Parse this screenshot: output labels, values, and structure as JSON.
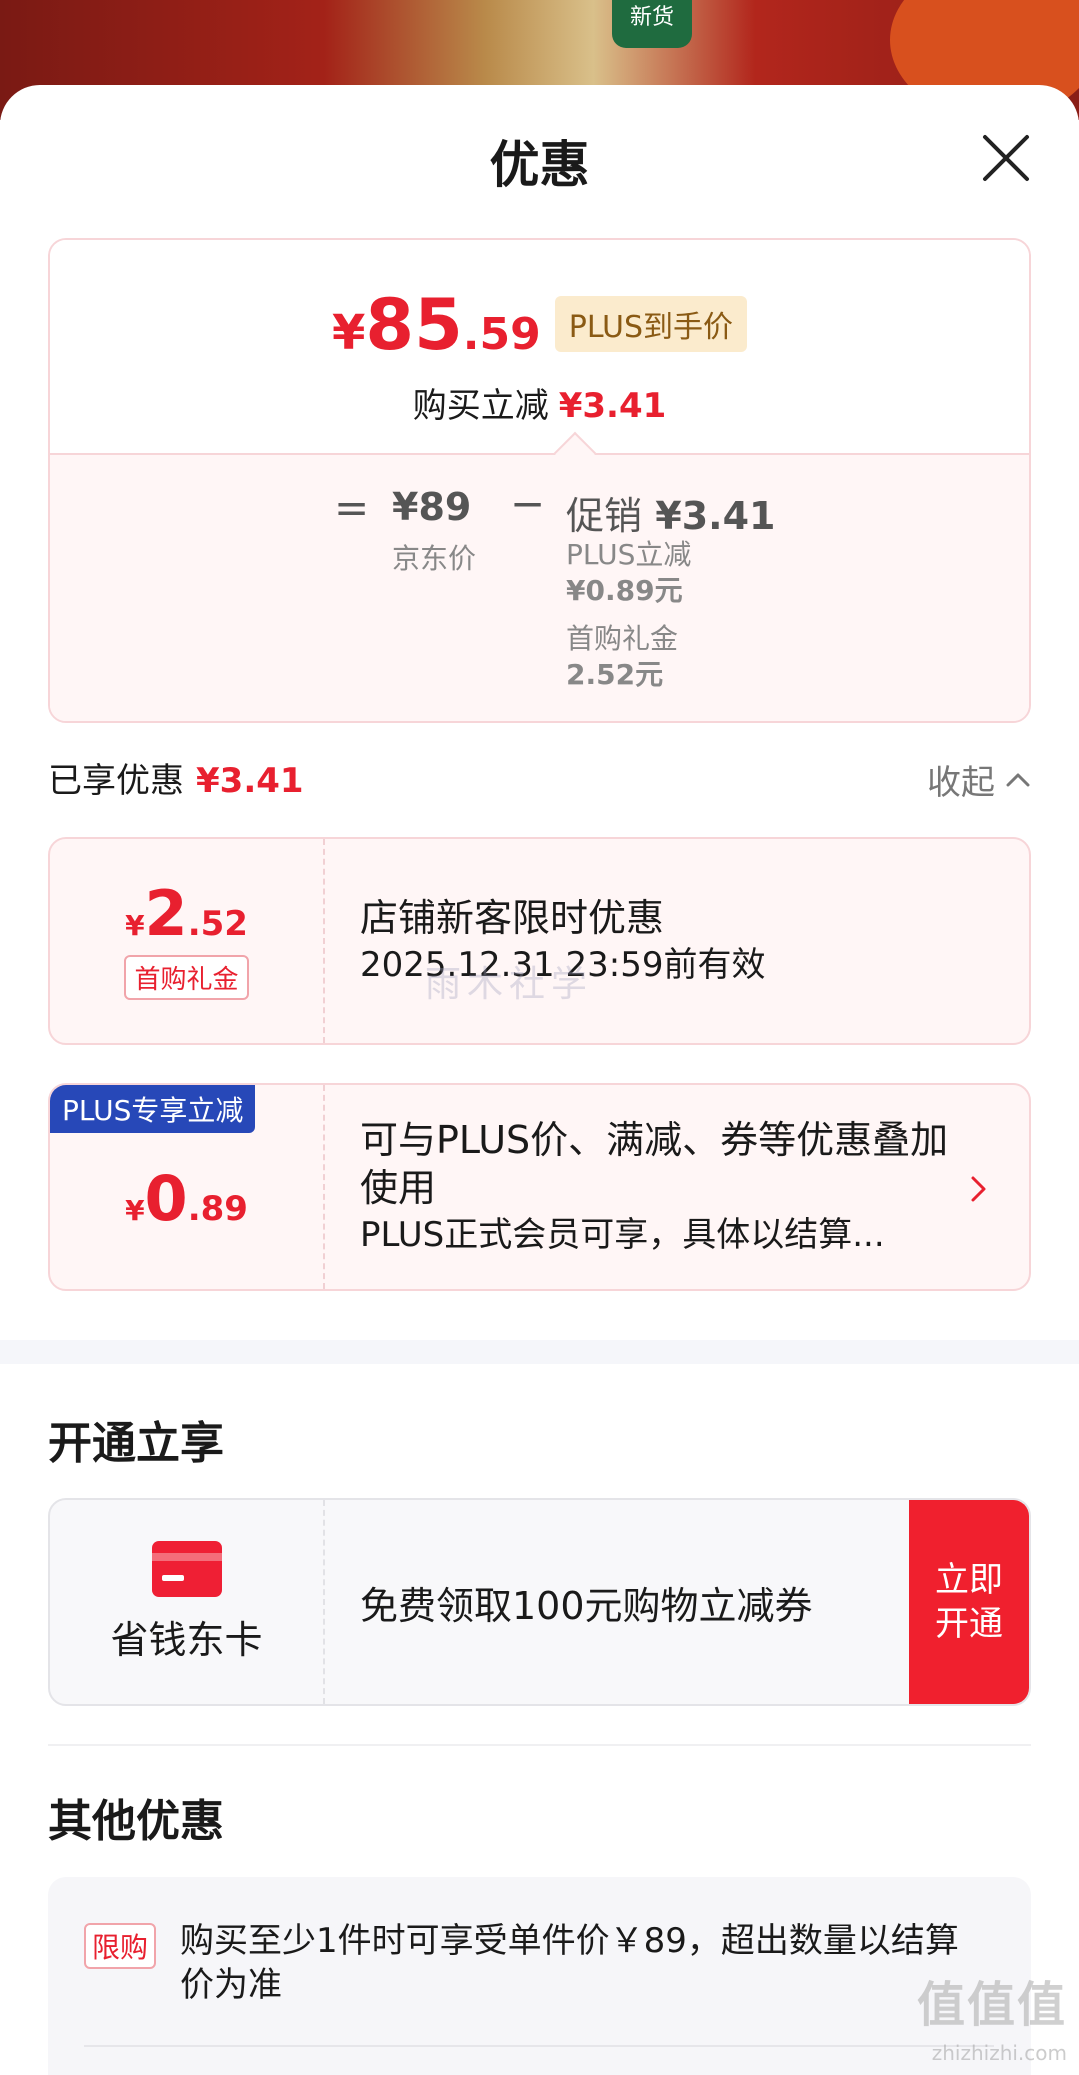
{
  "background": {
    "badge": "新货"
  },
  "sheet": {
    "title": "优惠"
  },
  "summary": {
    "price_yen": "¥",
    "price_int": "85",
    "price_dec": ".59",
    "plus_tag": "PLUS到手价",
    "reduce_label": "购买立减",
    "reduce_amount": "¥3.41",
    "equals": "=",
    "jd_price": "¥89",
    "jd_label": "京东价",
    "minus": "−",
    "promo_label": "促销",
    "promo_amount": "¥3.41",
    "plus_reduce_label": "PLUS立减",
    "plus_reduce_value": "¥0.89元",
    "first_gift_label": "首购礼金",
    "first_gift_value": "2.52元"
  },
  "enjoyed": {
    "label": "已享优惠",
    "amount": "¥3.41",
    "collapse_label": "收起"
  },
  "coupons": [
    {
      "yen": "¥",
      "int": "2",
      "dec": ".52",
      "tag": "首购礼金",
      "title": "店铺新客限时优惠",
      "subtitle": "2025.12.31 23:59前有效"
    },
    {
      "corner": "PLUS专享立减",
      "yen": "¥",
      "int": "0",
      "dec": ".89",
      "title": "可与PLUS价、满减、券等优惠叠加使用",
      "subtitle": "PLUS正式会员可享，具体以结算..."
    }
  ],
  "watermark": "雨木社学",
  "open_section": {
    "title": "开通立享",
    "card_name": "省钱东卡",
    "description": "免费领取100元购物立减券",
    "button_line1": "立即",
    "button_line2": "开通"
  },
  "other_section": {
    "title": "其他优惠",
    "tag": "限购",
    "text": "购买至少1件时可享受单件价￥89，超出数量以结算价为准"
  },
  "site": {
    "mark": "值值值",
    "url": "zhizhizhi.com"
  },
  "colors": {
    "accent_red": "#e8202f",
    "plus_blue": "#2748b8",
    "button_red": "#f0202e",
    "plus_tag_bg": "#fbebcd"
  }
}
